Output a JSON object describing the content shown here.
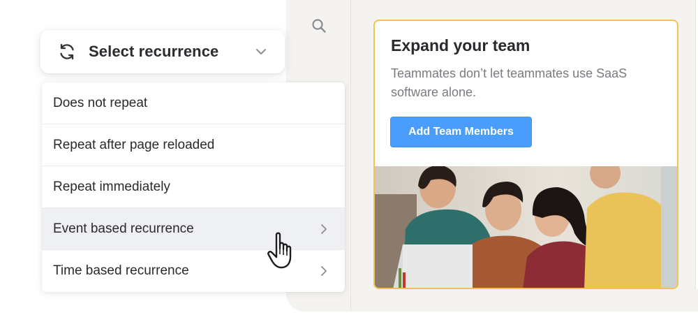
{
  "select": {
    "label": "Select recurrence",
    "icon": "refresh-icon",
    "chevron": "chevron-down-icon"
  },
  "menu": {
    "items": [
      {
        "label": "Does not repeat"
      },
      {
        "label": "Repeat after page reloaded"
      },
      {
        "label": "Repeat immediately"
      },
      {
        "label": "Event based recurrence",
        "has_submenu": true,
        "highlighted": true
      },
      {
        "label": "Time based recurrence",
        "has_submenu": true
      }
    ]
  },
  "card": {
    "title": "Expand your team",
    "body": "Teammates don’t let teammates use SaaS software alone.",
    "button_label": "Add Team Members",
    "accent_border": "#f5c254",
    "button_color": "#4a9dfb",
    "image": "team-photo"
  },
  "toolbar": {
    "icon": "search-icon"
  }
}
